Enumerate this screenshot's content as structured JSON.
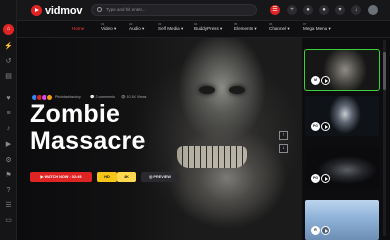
{
  "app": {
    "logo_text": "vidmov",
    "accent": "#e02424"
  },
  "search": {
    "placeholder": "Type and hit enter..."
  },
  "topbar": {
    "icons": [
      "menu-icon",
      "plus-icon",
      "bell-icon",
      "user-icon",
      "cart-icon",
      "download-icon",
      "avatar"
    ],
    "cart_count": "0"
  },
  "nav": {
    "items": [
      {
        "label": "Home",
        "num": "",
        "active": true
      },
      {
        "label": "Video",
        "num": "01"
      },
      {
        "label": "Audio",
        "num": "02"
      },
      {
        "label": "Self Media",
        "num": "03"
      },
      {
        "label": "BuddyPress",
        "num": "04"
      },
      {
        "label": "Elements",
        "num": "05"
      },
      {
        "label": "Channel",
        "num": "06"
      },
      {
        "label": "Mega Menu",
        "num": "07"
      }
    ]
  },
  "hero": {
    "channel": "Pitchdarkfactory",
    "comments": "2 comments",
    "views": "10.1K Views",
    "title_line1": "Zombie",
    "title_line2": "Massacre",
    "watch_label": "WATCH NOW : 02:49",
    "hd_label": "HD",
    "k4_label": "4K",
    "preview_label": "PREVIEW",
    "up_arrow": "↑",
    "down_arrow": "↓"
  },
  "thumbnails": [
    {
      "badge": "M",
      "selected": true
    },
    {
      "badge": "PG"
    },
    {
      "badge": "PG"
    },
    {
      "badge": "R"
    }
  ]
}
